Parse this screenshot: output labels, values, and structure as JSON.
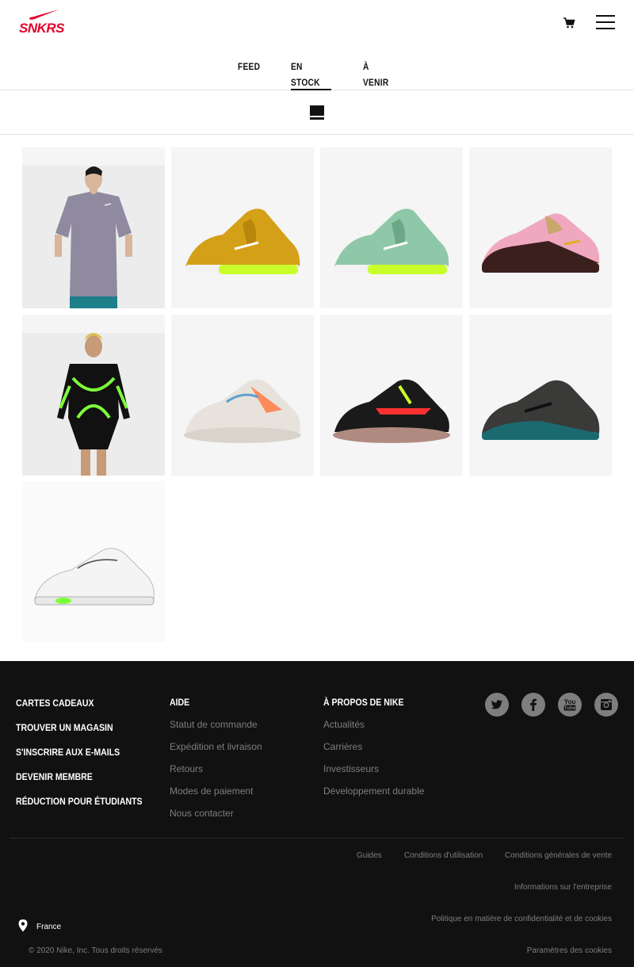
{
  "header": {
    "logo_text": "SNKRS",
    "tabs": [
      {
        "label": "Feed",
        "active": false
      },
      {
        "label": "En stock",
        "active": true
      },
      {
        "label": "À venir",
        "active": false
      }
    ]
  },
  "products": [
    {
      "kind": "tshirt",
      "colors": {
        "main": "#8f8aa0",
        "accent": "#1d7f8a"
      }
    },
    {
      "kind": "shoe",
      "colors": {
        "main": "#d4a017",
        "accent": "#c8ff2b"
      }
    },
    {
      "kind": "shoe",
      "colors": {
        "main": "#8fc8a8",
        "accent": "#c8ff2b"
      }
    },
    {
      "kind": "shoe",
      "colors": {
        "main": "#3a1f1c",
        "accent": "#f0a8c0"
      }
    },
    {
      "kind": "bodysuit",
      "colors": {
        "main": "#111111",
        "accent": "#7dff3a"
      }
    },
    {
      "kind": "shoe",
      "colors": {
        "main": "#e8e2dc",
        "accent": "#ff8a5a"
      }
    },
    {
      "kind": "shoe",
      "colors": {
        "main": "#1a1a1a",
        "accent": "#ff3030"
      }
    },
    {
      "kind": "shoe",
      "colors": {
        "main": "#3a3a38",
        "accent": "#1a6a70"
      }
    },
    {
      "kind": "shoe",
      "colors": {
        "main": "#f4f4f4",
        "accent": "#7dff3a"
      }
    }
  ],
  "footer": {
    "primary_links": [
      "Cartes cadeaux",
      "Trouver un magasin",
      "S'inscrire aux e-mails",
      "Devenir membre",
      "Réduction pour étudiants"
    ],
    "help": {
      "heading": "Aide",
      "links": [
        "Statut de commande",
        "Expédition et livraison",
        "Retours",
        "Modes de paiement",
        "Nous contacter"
      ]
    },
    "about": {
      "heading": "À propos de Nike",
      "links": [
        "Actualités",
        "Carrières",
        "Investisseurs",
        "Développement durable"
      ]
    },
    "social": [
      "twitter-icon",
      "facebook-icon",
      "youtube-icon",
      "instagram-icon"
    ],
    "legal": {
      "guides": "Guides",
      "terms_of_use": "Conditions d'utilisation",
      "terms_of_sale": "Conditions générales de vente",
      "company_info": "Informations sur l'entreprise",
      "privacy": "Politique en matière de confidentialité et de cookies",
      "cookie_settings": "Paramètres des cookies"
    },
    "location": "France",
    "copyright": "© 2020 Nike, Inc. Tous droits réservés"
  }
}
